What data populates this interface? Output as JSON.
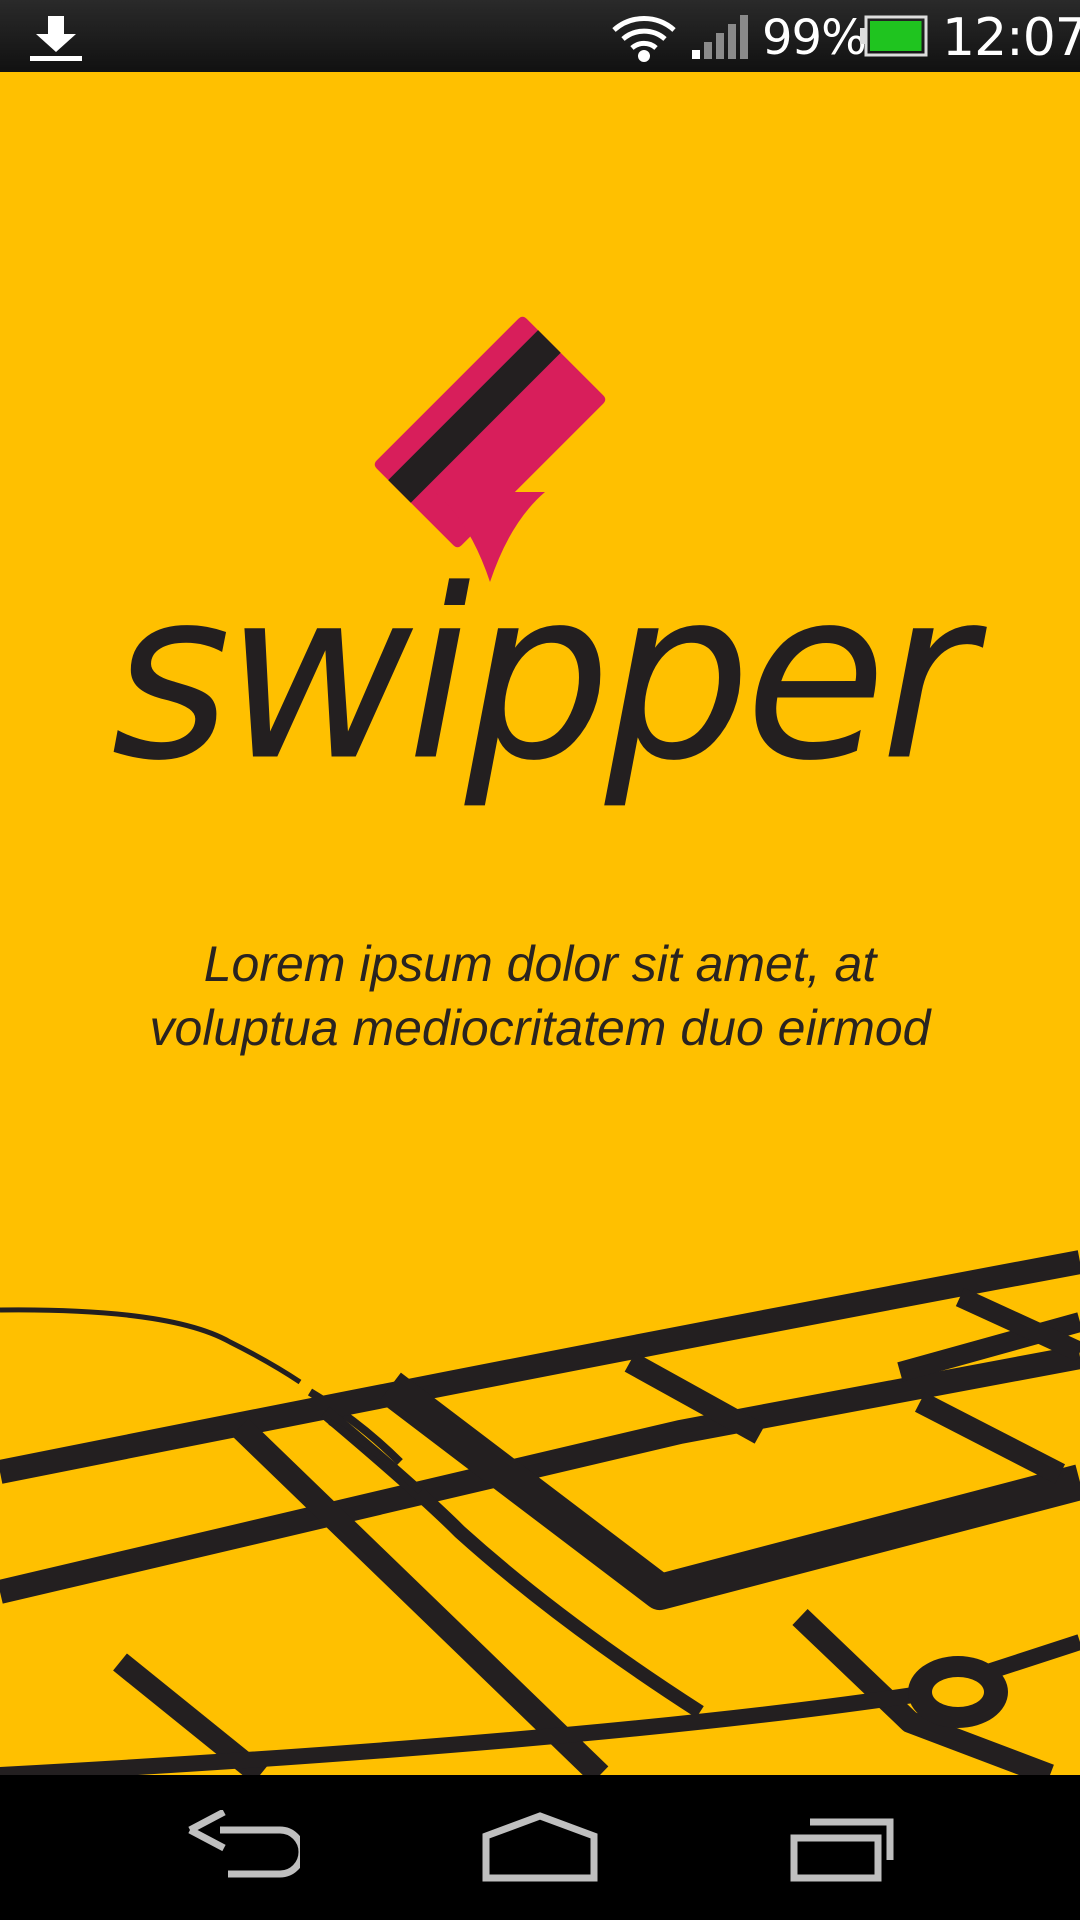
{
  "status_bar": {
    "download_icon": "download-icon",
    "wifi_icon": "wifi-icon",
    "signal_icon": "signal-icon",
    "battery_percent": "99%",
    "battery_icon": "battery-icon",
    "battery_level": 0.99,
    "battery_color": "#1fc41f",
    "time": "12:07"
  },
  "splash": {
    "logo_icon": "card-pin-icon",
    "app_name": "swipper",
    "tagline_line1": "Lorem ipsum dolor sit amet, at",
    "tagline_line2": "voluptua mediocritatem duo eirmod",
    "background_color": "#FFC000",
    "card_color": "#D81E5B",
    "ink_color": "#231F20"
  },
  "nav_bar": {
    "back_icon": "back-icon",
    "home_icon": "home-icon",
    "recent_apps_icon": "recent-apps-icon"
  }
}
